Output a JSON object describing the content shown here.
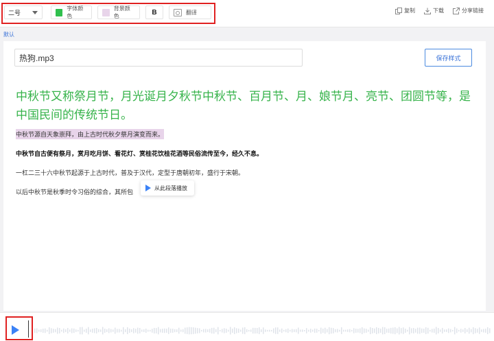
{
  "toolbar": {
    "font_size": "二号",
    "font_color_label": "字体颜色",
    "font_color": "#2fbf4d",
    "bg_color_label": "背景颜色",
    "bg_color": "#e8d4ea",
    "bold_label": "B",
    "translate_label": "翻译",
    "copy_label": "复制",
    "download_label": "下载",
    "share_label": "分享链接"
  },
  "preset_link": "默认",
  "editor": {
    "filename": "热狗.mp3",
    "save_label": "保存样式",
    "title_text": "中秋节又称祭月节，月光诞月夕秋节中秋节、百月节、月、娘节月、亮节、团圆节等，是中国民间的传统节日。",
    "p1": "中秋节源自天象崇拜，由上古时代秋夕祭月演变而来。",
    "p2": "中秋节自古便有祭月，赏月吃月饼、看花灯、赏桂花饮桂花酒等民俗流传至今，经久不息。",
    "p3": "一杠二三十六中秋节起源于上古时代，普及于汉代，定型于唐朝初年，盛行于宋朝。",
    "p4": "以后中秋节是秋季时令习俗的综合，其所包"
  },
  "popup": {
    "label": "从此段落播放"
  },
  "colors": {
    "accent": "#3b82f6",
    "title_green": "#36b34a",
    "highlight_red": "#e02020"
  }
}
